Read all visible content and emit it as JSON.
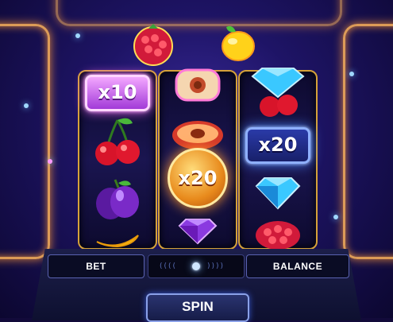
{
  "reels": [
    {
      "symbols": [
        "x10",
        "cherry-icon",
        "plum-icon",
        "banana-icon"
      ],
      "multiplier": "x10"
    },
    {
      "symbols": [
        "plum-half-icon",
        "peach-icon",
        "x20",
        "diamond-purple-icon"
      ],
      "multiplier": "x20"
    },
    {
      "symbols": [
        "diamond-blue-icon",
        "cherry-icon",
        "x20",
        "diamond-blue-icon",
        "raspberry-icon"
      ],
      "multiplier": "x20"
    }
  ],
  "top_symbols": [
    "raspberry-icon",
    "lemon-icon"
  ],
  "multipliers": {
    "reel1_top": "x10",
    "reel2_mid": "x20",
    "reel3_mid": "x20"
  },
  "controls": {
    "bet_label": "BET",
    "balance_label": "BALANCE",
    "spin_label": "SPIN"
  },
  "colors": {
    "frame": "#d6a23a",
    "neon": "#ffb45a",
    "accent_purple": "#c45ae8",
    "accent_blue": "#4a8aff"
  }
}
